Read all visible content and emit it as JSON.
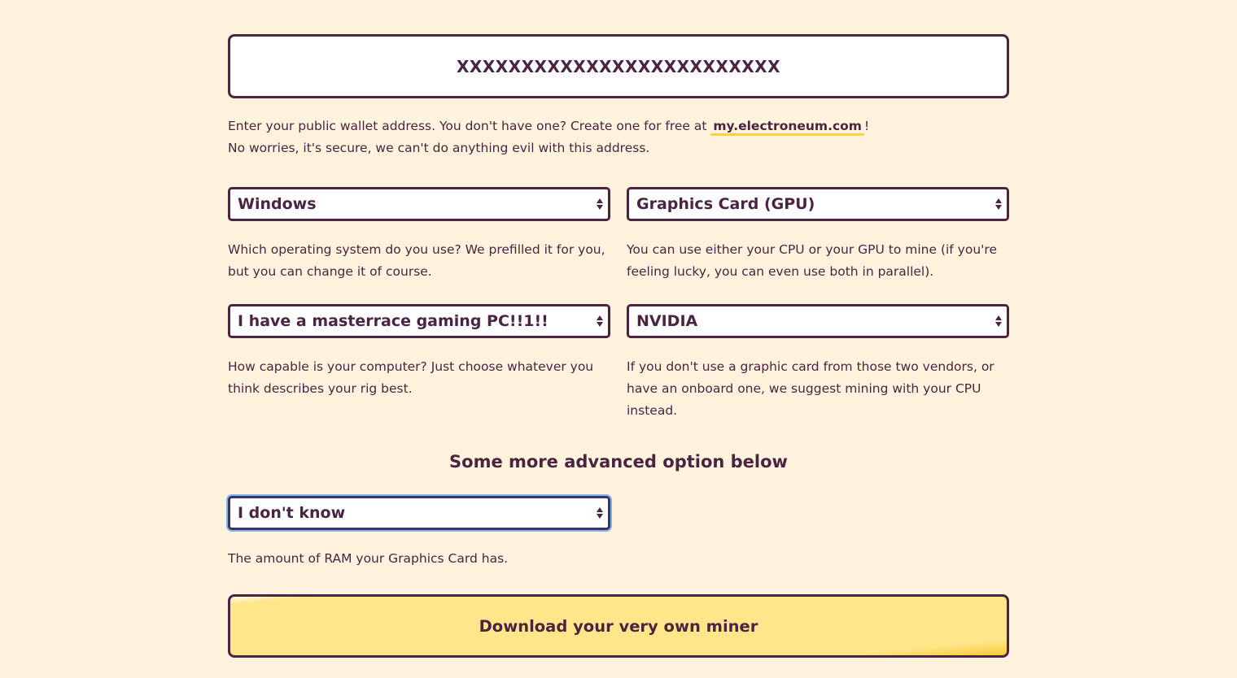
{
  "wallet": {
    "value": "XXXXXXXXXXXXXXXXXXXXXXXXX",
    "help_text": "Enter your public wallet address. You don't have one? Create one for free at ",
    "link_text": "my.electroneum.com",
    "help_suffix": "!",
    "help_line2": "No worries, it's secure, we can't do anything evil with this address."
  },
  "os_select": {
    "value": "Windows",
    "help": "Which operating system do you use? We prefilled it for you, but you can change it of course."
  },
  "device_select": {
    "value": "Graphics Card (GPU)",
    "help": "You can use either your CPU or your GPU to mine (if you're feeling lucky, you can even use both in parallel)."
  },
  "power_select": {
    "value": "I have a masterrace gaming PC!!1!!",
    "help": "How capable is your computer? Just choose whatever you think describes your rig best."
  },
  "vendor_select": {
    "value": "NVIDIA",
    "help": "If you don't use a graphic card from those two vendors, or have an onboard one, we suggest mining with your CPU instead."
  },
  "advanced": {
    "heading": "Some more advanced option below"
  },
  "ram_select": {
    "value": "I don't know",
    "help": "The amount of RAM your Graphics Card has."
  },
  "download": {
    "label": "Download your very own miner"
  },
  "colors": {
    "background": "#fff3dd",
    "text": "#4a2440",
    "accent": "#f9d33a",
    "button": "#ffe68a"
  }
}
